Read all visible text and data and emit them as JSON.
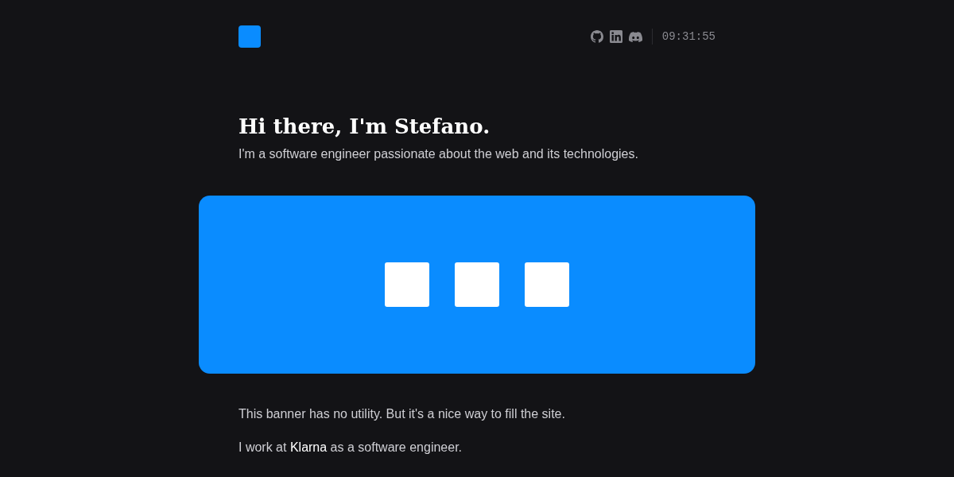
{
  "header": {
    "time": "09:31:55",
    "social_icons": [
      {
        "kind": "github"
      },
      {
        "kind": "linkedin"
      },
      {
        "kind": "discord"
      }
    ]
  },
  "intro": {
    "heading": "Hi there, I'm Stefano.",
    "tagline": "I'm a software engineer passionate about the web and its technologies."
  },
  "paragraphs": [
    [
      {
        "text": "This banner has no utility. But it's a nice way to fill the site.",
        "link": false
      }
    ],
    [
      {
        "text": "I work at ",
        "link": false
      },
      {
        "text": "Klarna",
        "link": true
      },
      {
        "text": " as a software engineer.",
        "link": false
      }
    ]
  ]
}
